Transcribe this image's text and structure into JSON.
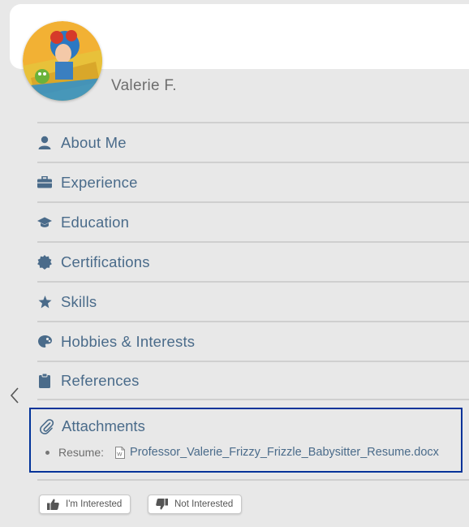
{
  "profile": {
    "name": "Valerie F."
  },
  "nav": {
    "items": [
      {
        "label": "About Me",
        "icon": "person-icon"
      },
      {
        "label": "Experience",
        "icon": "briefcase-icon"
      },
      {
        "label": "Education",
        "icon": "graduation-cap-icon"
      },
      {
        "label": "Certifications",
        "icon": "certificate-icon"
      },
      {
        "label": "Skills",
        "icon": "star-icon"
      },
      {
        "label": "Hobbies & Interests",
        "icon": "palette-icon"
      },
      {
        "label": "References",
        "icon": "clipboard-icon"
      }
    ]
  },
  "attachments": {
    "title": "Attachments",
    "icon": "paperclip-icon",
    "items": [
      {
        "label": "Resume:",
        "filename": "Professor_Valerie_Frizzy_Frizzle_Babysitter_Resume.docx",
        "icon": "word-doc-icon"
      }
    ]
  },
  "actions": {
    "interested": "I'm Interested",
    "not_interested": "Not Interested"
  },
  "colors": {
    "accent_text": "#4a6b8a",
    "highlight_border": "#003399",
    "background": "#e8e8e8"
  }
}
